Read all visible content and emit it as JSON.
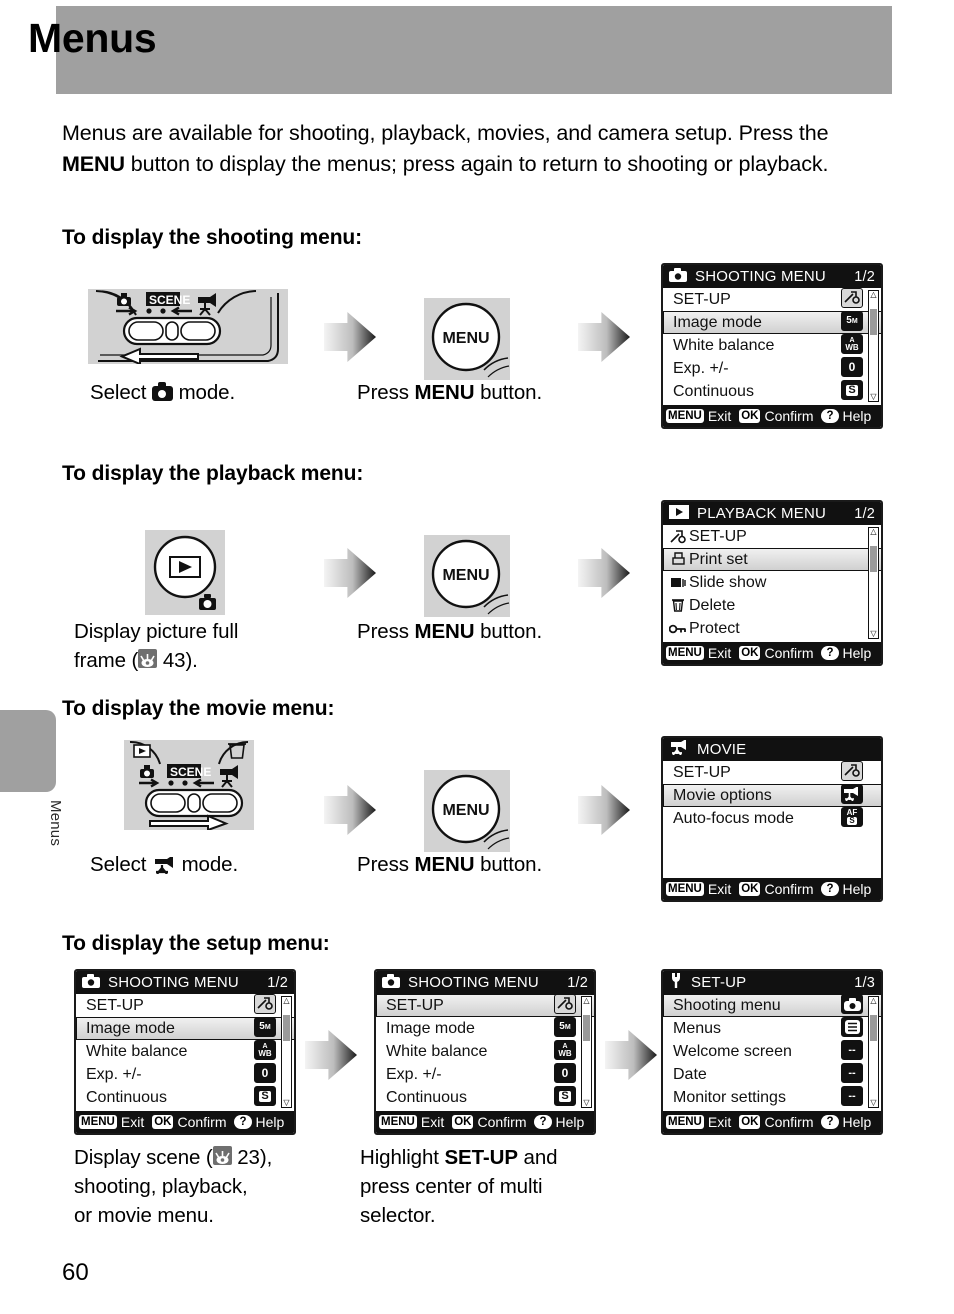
{
  "side_tab": {
    "label": "Menus"
  },
  "header": {
    "title": "Menus"
  },
  "intro": {
    "part1": "Menus are available for shooting, playback, movies, and camera setup. Press the ",
    "bold1": "MENU",
    "part2": " button to display the menus; press again to return to shooting or playback."
  },
  "sections": {
    "shooting": "To display the shooting menu:",
    "playback": "To display the playback menu:",
    "movie": "To display the movie menu:",
    "setup": "To display the setup menu:"
  },
  "steps": {
    "select_mode_pre": "Select ",
    "select_mode_post": " mode.",
    "press_menu_pre": "Press ",
    "press_menu_bold": "MENU",
    "press_menu_post": " button.",
    "display_full_frame_line1": "Display picture full",
    "display_full_frame_line2_pre": "frame (",
    "display_full_frame_page": "43",
    "display_full_frame_line2_post": ").",
    "display_scene_pre": "Display scene (",
    "display_scene_page": "23",
    "display_scene_post": "),",
    "display_scene_line2": "shooting, playback,",
    "display_scene_line3": "or movie menu.",
    "highlight_pre": "Highlight ",
    "highlight_bold": "SET-UP",
    "highlight_post": " and",
    "highlight_line2": "press center of multi",
    "highlight_line3": "selector.",
    "menu_button_label": "MENU",
    "scene_label": "SCENE"
  },
  "lcd_footer": {
    "menu_key": "MENU",
    "exit": "Exit",
    "ok_key": "OK",
    "confirm": "Confirm",
    "help_key": "?",
    "help": "Help"
  },
  "screens": {
    "shooting_menu": {
      "title": "SHOOTING MENU",
      "page": "1/2",
      "title_icon": "camera-icon",
      "selected_index": 1,
      "items": [
        {
          "label": "SET-UP",
          "value_icon": "wrench-arrow",
          "value_text": "",
          "value_sub": "",
          "value_style": "light"
        },
        {
          "label": "Image mode",
          "value_icon": "image-size",
          "value_text": "5",
          "value_sub": "M",
          "value_style": "dark"
        },
        {
          "label": "White balance",
          "value_icon": "auto-wb",
          "value_text": "A",
          "value_sub": "WB",
          "value_style": "dark"
        },
        {
          "label": "Exp. +/-",
          "value_icon": "exposure-zero",
          "value_text": "0",
          "value_sub": "",
          "value_style": "dark"
        },
        {
          "label": "Continuous",
          "value_icon": "single-shot",
          "value_text": "S",
          "value_sub": "",
          "value_style": "dark"
        }
      ]
    },
    "shooting_menu_setup_selected": {
      "title": "SHOOTING MENU",
      "page": "1/2",
      "title_icon": "camera-icon",
      "selected_index": 0,
      "items": [
        {
          "label": "SET-UP",
          "value_icon": "wrench-arrow",
          "value_text": "",
          "value_sub": "",
          "value_style": "light"
        },
        {
          "label": "Image mode",
          "value_icon": "image-size",
          "value_text": "5",
          "value_sub": "M",
          "value_style": "dark"
        },
        {
          "label": "White balance",
          "value_icon": "auto-wb",
          "value_text": "A",
          "value_sub": "WB",
          "value_style": "dark"
        },
        {
          "label": "Exp. +/-",
          "value_icon": "exposure-zero",
          "value_text": "0",
          "value_sub": "",
          "value_style": "dark"
        },
        {
          "label": "Continuous",
          "value_icon": "single-shot",
          "value_text": "S",
          "value_sub": "",
          "value_style": "dark"
        }
      ]
    },
    "playback_menu": {
      "title": "PLAYBACK MENU",
      "page": "1/2",
      "title_icon": "playback-icon",
      "selected_index": 1,
      "items": [
        {
          "label": "SET-UP",
          "row_icon": "wrench-arrow-icon"
        },
        {
          "label": "Print set",
          "row_icon": "printer-icon"
        },
        {
          "label": "Slide show",
          "row_icon": "slideshow-icon"
        },
        {
          "label": "Delete",
          "row_icon": "trash-icon"
        },
        {
          "label": "Protect",
          "row_icon": "key-icon"
        }
      ]
    },
    "movie_menu": {
      "title": "MOVIE",
      "page": "",
      "title_icon": "movie-camera-icon",
      "selected_index": 1,
      "items": [
        {
          "label": "SET-UP",
          "value_icon": "wrench-arrow",
          "value_text": "",
          "value_sub": "",
          "value_style": "light"
        },
        {
          "label": "Movie options",
          "value_icon": "movie-camera",
          "value_text": "",
          "value_sub": "",
          "value_style": "dark"
        },
        {
          "label": "Auto-focus mode",
          "value_icon": "af-single",
          "value_text": "AF",
          "value_sub": "S",
          "value_style": "dark"
        }
      ]
    },
    "setup_menu": {
      "title": "SET-UP",
      "page": "1/3",
      "title_icon": "wrench-icon",
      "selected_index": 0,
      "items": [
        {
          "label": "Shooting menu",
          "value_icon": "camera-badge",
          "value_text": "",
          "value_sub": "",
          "value_style": "dark"
        },
        {
          "label": "Menus",
          "value_icon": "menu-list",
          "value_text": "",
          "value_sub": "",
          "value_style": "dark"
        },
        {
          "label": "Welcome screen",
          "value_icon": "dashes",
          "value_text": "--",
          "value_sub": "",
          "value_style": "dark"
        },
        {
          "label": "Date",
          "value_icon": "dashes",
          "value_text": "--",
          "value_sub": "",
          "value_style": "dark"
        },
        {
          "label": "Monitor settings",
          "value_icon": "dashes",
          "value_text": "--",
          "value_sub": "",
          "value_style": "dark"
        }
      ]
    }
  },
  "page_number": "60",
  "colors": {
    "band_gray": "#a0a0a0",
    "lcd_black": "#111111",
    "illustration_gray": "#d2d2d2",
    "selection_gray": "#dcdcdc"
  }
}
